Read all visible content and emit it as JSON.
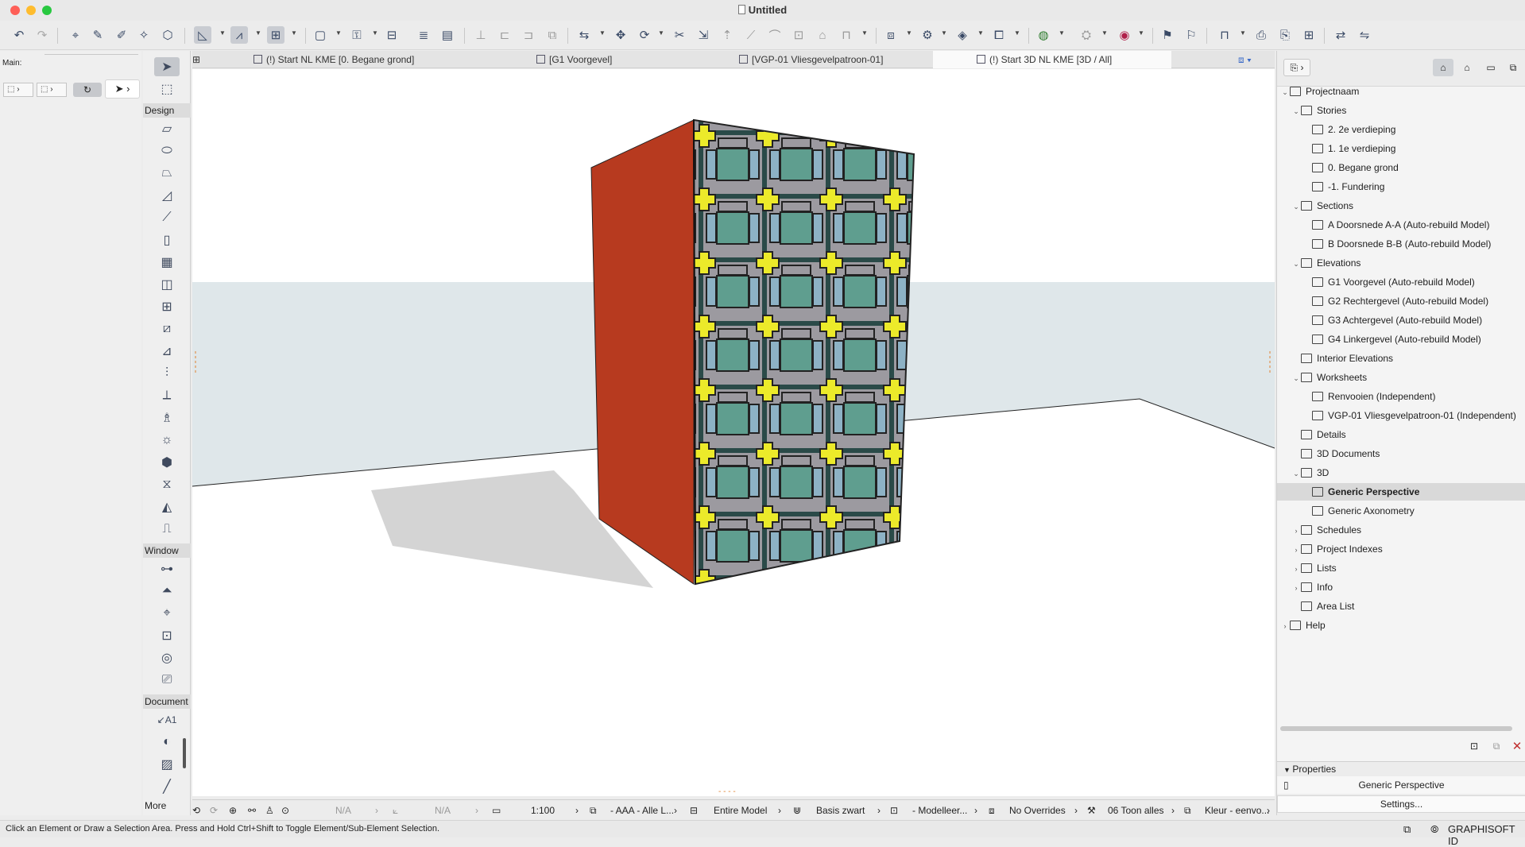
{
  "window": {
    "title": "Untitled"
  },
  "colors": {
    "accent": "#3a4a66",
    "wall_red": "#b73a1f",
    "tile_teal": "#5f9e8f",
    "tile_yellow": "#ecea2a",
    "tile_blue": "#8db2c5",
    "tile_gray": "#9c9aa0",
    "frame_dark": "#2a4a48"
  },
  "left_panel": {
    "main_label": "Main:"
  },
  "toolbox": {
    "sections": {
      "design": "Design",
      "window": "Window",
      "document": "Document",
      "more": "More"
    },
    "document_first_tool": "A1"
  },
  "tabs": [
    {
      "label": "(!) Start NL KME [0. Begane grond]",
      "icon": "floor-plan-icon"
    },
    {
      "label": "[G1 Voorgevel]",
      "icon": "elevation-icon"
    },
    {
      "label": "[VGP-01 Vliesgevelpatroon-01]",
      "icon": "worksheet-icon"
    },
    {
      "label": "(!) Start 3D NL KME [3D / All]",
      "icon": "3d-view-icon"
    }
  ],
  "navigator": {
    "root": "Projectnaam",
    "items": [
      {
        "label": "Stories",
        "level": 1,
        "expanded": true
      },
      {
        "label": "2. 2e verdieping",
        "level": 2
      },
      {
        "label": "1. 1e verdieping",
        "level": 2
      },
      {
        "label": "0. Begane grond",
        "level": 2
      },
      {
        "label": "-1. Fundering",
        "level": 2
      },
      {
        "label": "Sections",
        "level": 1,
        "expanded": true
      },
      {
        "label": "A Doorsnede A-A (Auto-rebuild Model)",
        "level": 2
      },
      {
        "label": "B Doorsnede B-B (Auto-rebuild Model)",
        "level": 2
      },
      {
        "label": "Elevations",
        "level": 1,
        "expanded": true
      },
      {
        "label": "G1 Voorgevel (Auto-rebuild Model)",
        "level": 2
      },
      {
        "label": "G2 Rechtergevel (Auto-rebuild Model)",
        "level": 2
      },
      {
        "label": "G3 Achtergevel (Auto-rebuild Model)",
        "level": 2
      },
      {
        "label": "G4 Linkergevel (Auto-rebuild Model)",
        "level": 2
      },
      {
        "label": "Interior Elevations",
        "level": 1
      },
      {
        "label": "Worksheets",
        "level": 1,
        "expanded": true
      },
      {
        "label": "Renvooien (Independent)",
        "level": 2
      },
      {
        "label": "VGP-01 Vliesgevelpatroon-01 (Independent)",
        "level": 2
      },
      {
        "label": "Details",
        "level": 1
      },
      {
        "label": "3D Documents",
        "level": 1
      },
      {
        "label": "3D",
        "level": 1,
        "expanded": true
      },
      {
        "label": "Generic Perspective",
        "level": 2,
        "selected": true
      },
      {
        "label": "Generic Axonometry",
        "level": 2
      },
      {
        "label": "Schedules",
        "level": 1,
        "collapsed": true
      },
      {
        "label": "Project Indexes",
        "level": 1,
        "collapsed": true
      },
      {
        "label": "Lists",
        "level": 1,
        "collapsed": true
      },
      {
        "label": "Info",
        "level": 1,
        "collapsed": true
      },
      {
        "label": "Area List",
        "level": 1
      },
      {
        "label": "Help",
        "level": 0,
        "collapsed": true
      }
    ]
  },
  "properties": {
    "header": "Properties",
    "view_name": "Generic Perspective",
    "settings_button": "Settings..."
  },
  "quick_options": {
    "na_1": "N/A",
    "na_2": "N/A",
    "scale": "1:100",
    "layer_combo": "- AAA - Alle L...",
    "model_view": "Entire Model",
    "pen_set": "Basis zwart",
    "model_view_options": "- Modelleer...",
    "overrides": "No Overrides",
    "renovation": "06 Toon alles",
    "color": "Kleur - eenvo..."
  },
  "status": {
    "hint": "Click an Element or Draw a Selection Area. Press and Hold Ctrl+Shift to Toggle Element/Sub-Element Selection.",
    "brand": "GRAPHISOFT ID"
  }
}
